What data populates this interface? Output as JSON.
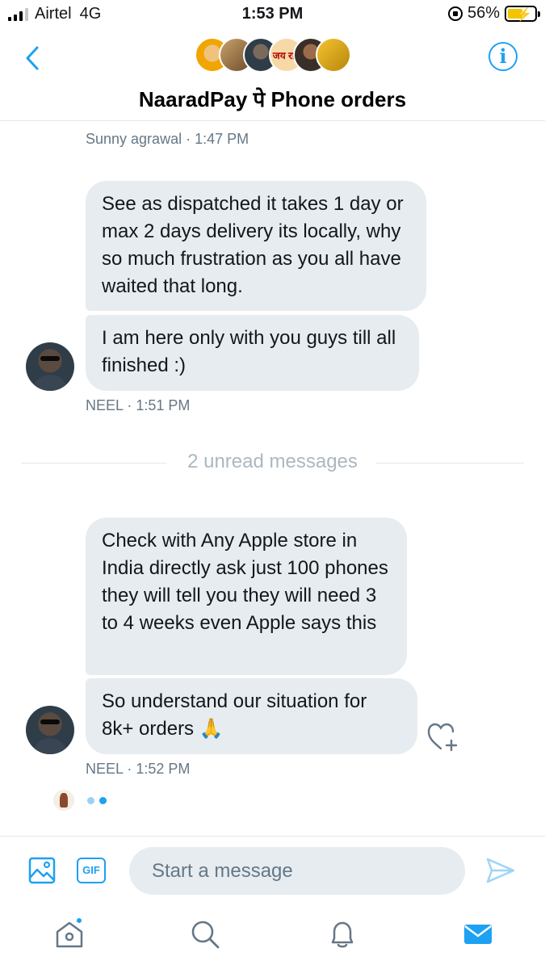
{
  "status_bar": {
    "carrier": "Airtel",
    "network": "4G",
    "time": "1:53 PM",
    "battery_percent": "56%",
    "battery_level": 0.56
  },
  "header": {
    "title": "NaaradPay पे Phone orders",
    "group_avatar_text": "जय राम",
    "back_icon": "chevron-left-icon",
    "info_icon": "info-icon"
  },
  "messages": [
    {
      "sender_meta": "Sunny agrawal · 1:47 PM",
      "bubbles": [
        "See as dispatched it takes 1 day or max 2 days delivery its locally, why so much frustration as you all have waited that long.",
        "I am here only with you guys till all finished :)"
      ],
      "meta": "NEEL · 1:51 PM"
    },
    {
      "bubbles": [
        "Check with Any Apple store in India directly ask just 100 phones they will tell you they will need 3 to 4 weeks even Apple says this",
        "So understand our situation for 8k+ orders 🙏"
      ],
      "meta": "NEEL · 1:52 PM"
    }
  ],
  "unread_divider": "2 unread messages",
  "composer": {
    "placeholder": "Start a message",
    "gif_label": "GIF",
    "image_icon": "image-icon",
    "send_icon": "send-icon"
  },
  "tabbar": {
    "items": [
      "home-icon",
      "search-icon",
      "bell-icon",
      "mail-icon"
    ],
    "active": "mail-icon"
  },
  "colors": {
    "accent": "#1da1f2",
    "bubble_bg": "#e6ecf0",
    "meta_text": "#657786"
  }
}
